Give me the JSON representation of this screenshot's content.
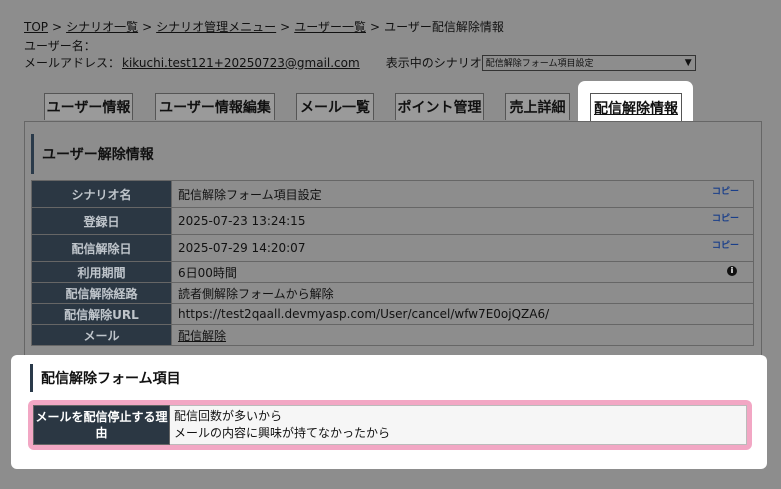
{
  "breadcrumb": {
    "items": [
      "TOP",
      "シナリオ一覧",
      "シナリオ管理メニュー",
      "ユーザー一覧"
    ],
    "current": "ユーザー配信解除情報",
    "separator": ">"
  },
  "user": {
    "name_label": "ユーザー名：",
    "email_label": "メールアドレス：",
    "email": "kikuchi.test121+20250723@gmail.com"
  },
  "scenario": {
    "label": "表示中のシナリオ",
    "selected": "配信解除フォーム項目設定"
  },
  "tabs": [
    {
      "label": "ユーザー情報"
    },
    {
      "label": "ユーザー情報編集"
    },
    {
      "label": "メール一覧"
    },
    {
      "label": "ポイント管理"
    },
    {
      "label": "売上詳細"
    },
    {
      "label": "配信解除情報",
      "active": true
    }
  ],
  "unsubscribe_info": {
    "title": "ユーザー解除情報",
    "copy_label": "コピー",
    "rows": [
      {
        "label": "シナリオ名",
        "value": "配信解除フォーム項目設定"
      },
      {
        "label": "登録日",
        "value": "2025-07-23 13:24:15"
      },
      {
        "label": "配信解除日",
        "value": "2025-07-29 14:20:07"
      },
      {
        "label": "利用期間",
        "value": "6日00時間"
      },
      {
        "label": "配信解除経路",
        "value": "読者側解除フォームから解除"
      },
      {
        "label": "配信解除URL",
        "value": "https://test2qaall.devmyasp.com/User/cancel/wfw7E0ojQZA6/"
      },
      {
        "label": "メール",
        "value": "配信解除"
      }
    ]
  },
  "form_items": {
    "title": "配信解除フォーム項目",
    "row_label_line1": "メールを配信停止する理",
    "row_label_line2": "由",
    "row_values": [
      "配信回数が多いから",
      "メールの内容に興味が持てなかったから"
    ]
  },
  "colors": {
    "header_cell": "#2b3743",
    "highlight": "#f2a7c4",
    "dim_overlay": "#8d8d8d"
  }
}
